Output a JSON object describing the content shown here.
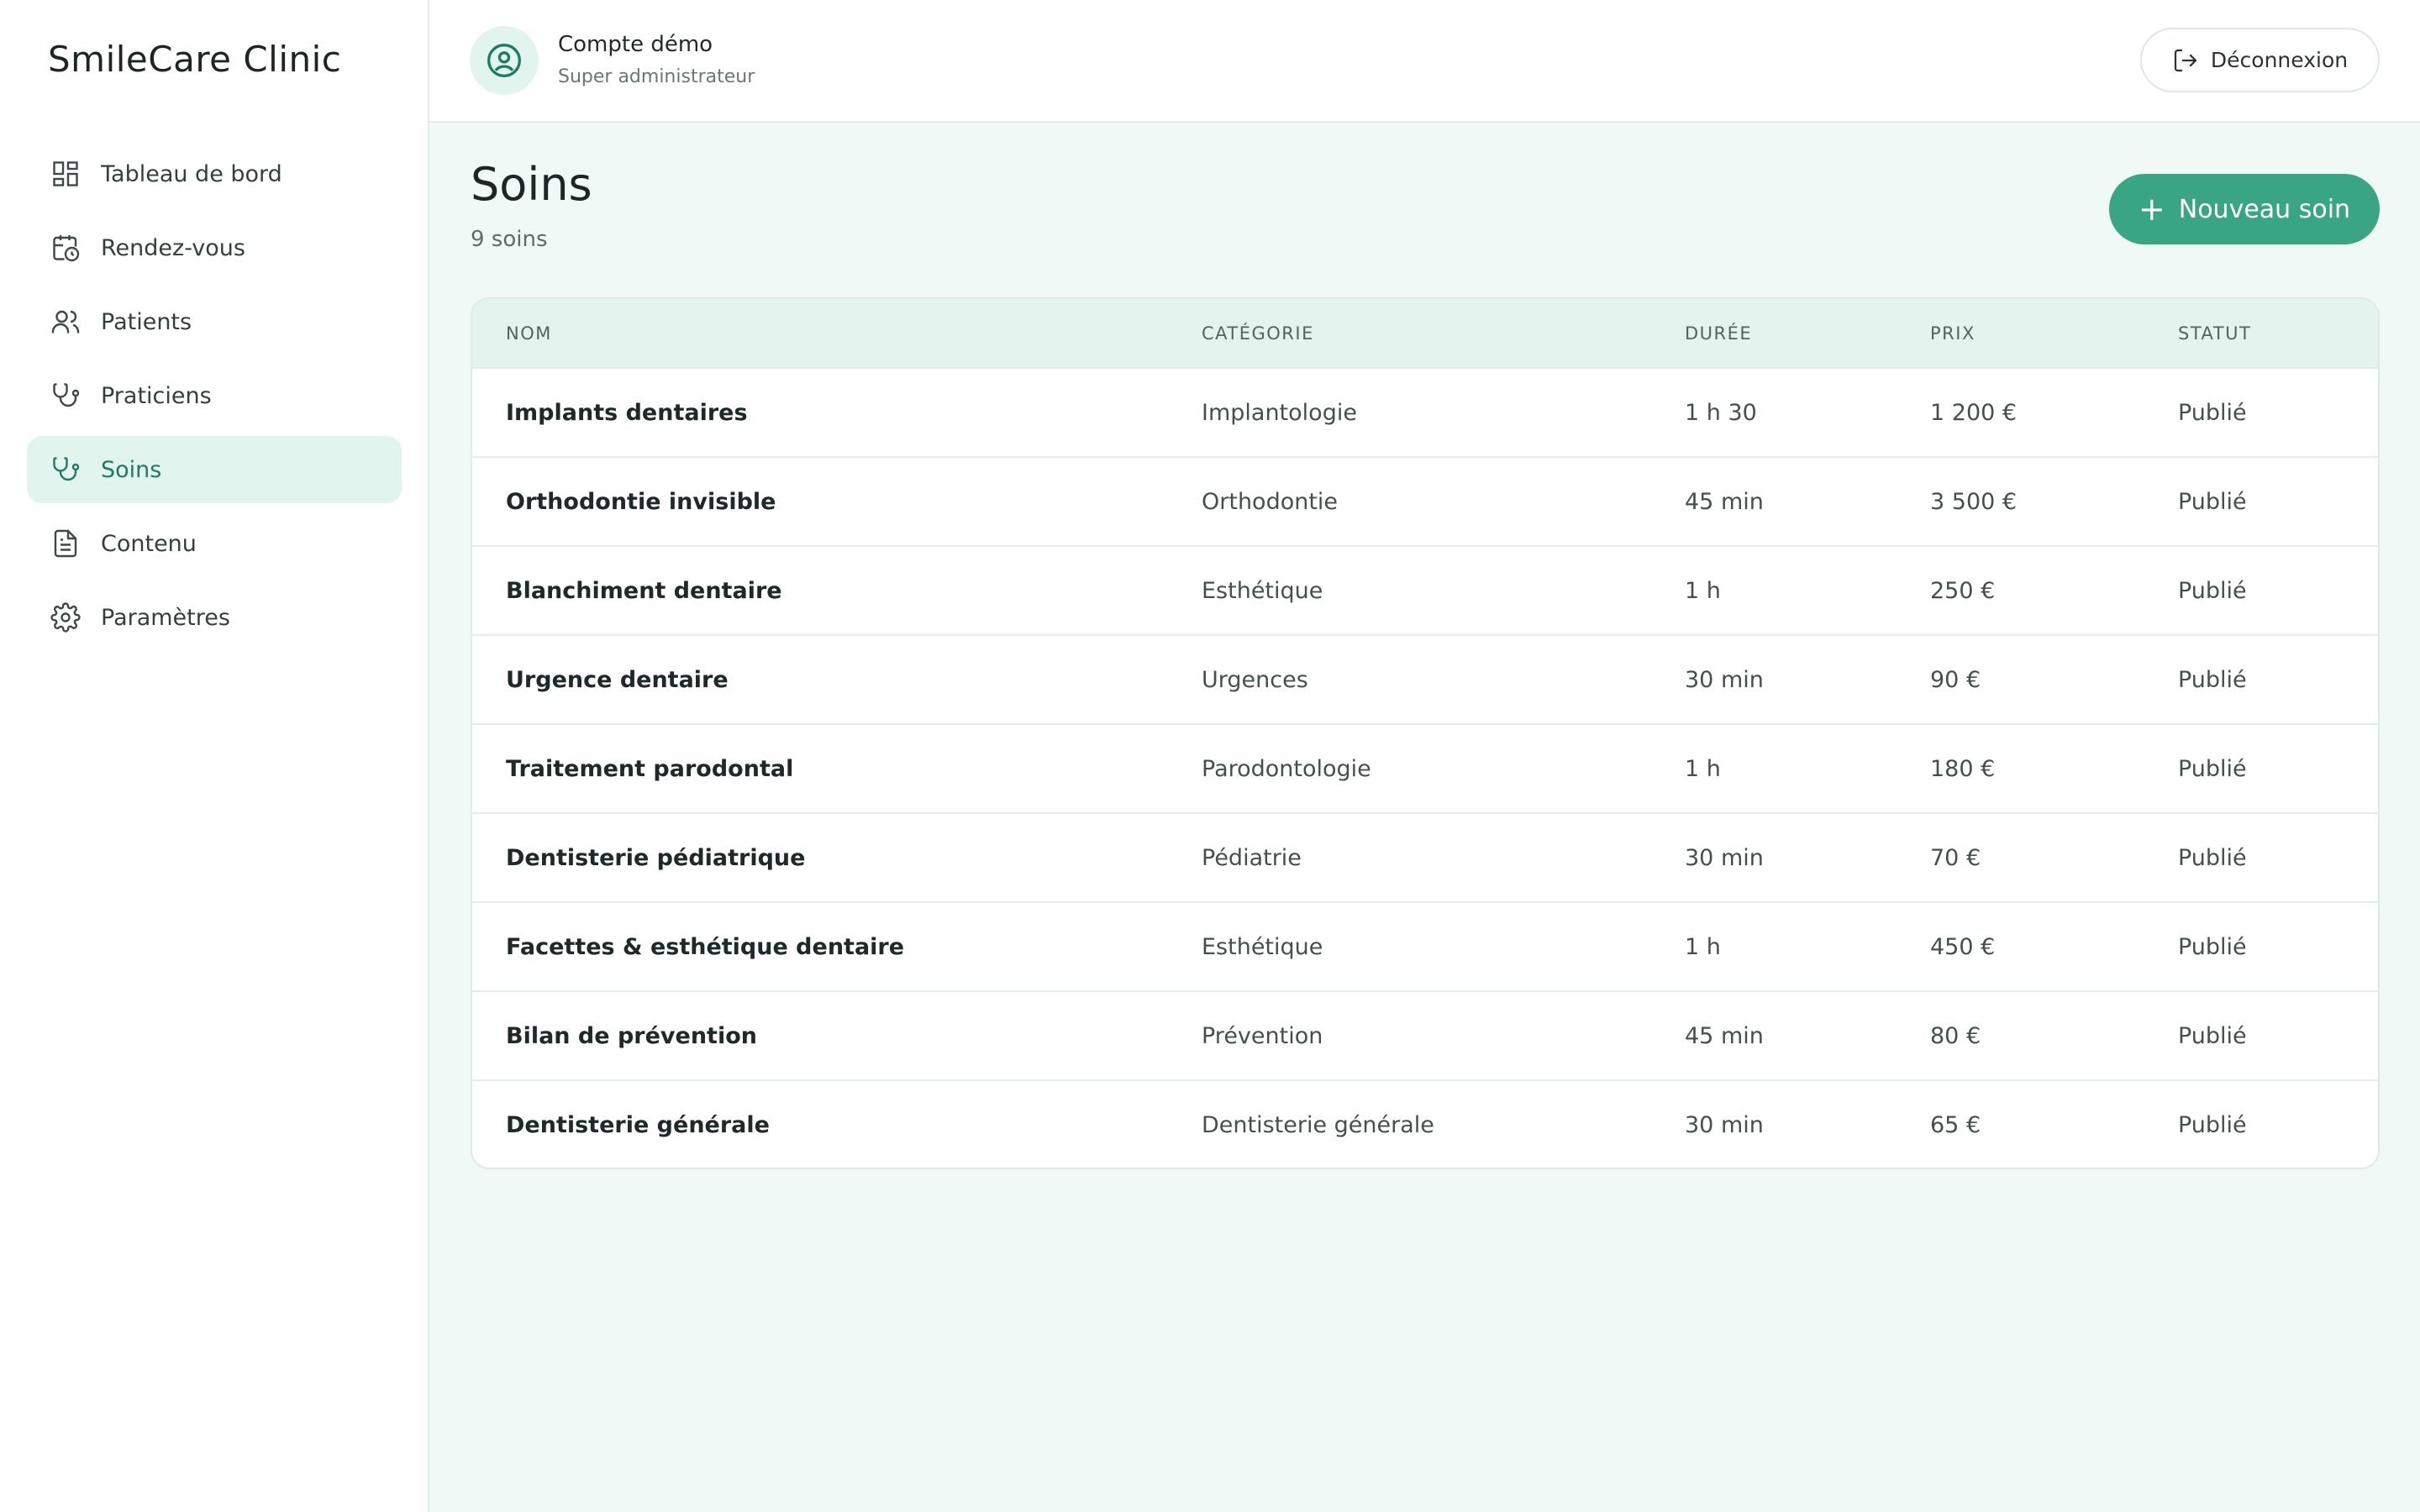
{
  "brand": "SmileCare Clinic",
  "sidebar": {
    "items": [
      {
        "label": "Tableau de bord",
        "icon": "dashboard-icon"
      },
      {
        "label": "Rendez-vous",
        "icon": "calendar-clock-icon"
      },
      {
        "label": "Patients",
        "icon": "users-icon"
      },
      {
        "label": "Praticiens",
        "icon": "stethoscope-icon"
      },
      {
        "label": "Soins",
        "icon": "stethoscope-icon",
        "active": true
      },
      {
        "label": "Contenu",
        "icon": "document-icon"
      },
      {
        "label": "Paramètres",
        "icon": "gear-icon"
      }
    ]
  },
  "header": {
    "account_name": "Compte démo",
    "account_role": "Super administrateur",
    "logout_label": "Déconnexion"
  },
  "page": {
    "title": "Soins",
    "count": "9 soins",
    "new_button": "Nouveau soin"
  },
  "table": {
    "columns": [
      "NOM",
      "CATÉGORIE",
      "DURÉE",
      "PRIX",
      "STATUT"
    ],
    "rows": [
      [
        "Implants dentaires",
        "Implantologie",
        "1 h 30",
        "1 200 €",
        "Publié"
      ],
      [
        "Orthodontie invisible",
        "Orthodontie",
        "45 min",
        "3 500 €",
        "Publié"
      ],
      [
        "Blanchiment dentaire",
        "Esthétique",
        "1 h",
        "250 €",
        "Publié"
      ],
      [
        "Urgence dentaire",
        "Urgences",
        "30 min",
        "90 €",
        "Publié"
      ],
      [
        "Traitement parodontal",
        "Parodontologie",
        "1 h",
        "180 €",
        "Publié"
      ],
      [
        "Dentisterie pédiatrique",
        "Pédiatrie",
        "30 min",
        "70 €",
        "Publié"
      ],
      [
        "Facettes & esthétique dentaire",
        "Esthétique",
        "1 h",
        "450 €",
        "Publié"
      ],
      [
        "Bilan de prévention",
        "Prévention",
        "45 min",
        "80 €",
        "Publié"
      ],
      [
        "Dentisterie générale",
        "Dentisterie générale",
        "30 min",
        "65 €",
        "Publié"
      ]
    ]
  },
  "colors": {
    "accent": "#3aa583",
    "accent_light": "#e1f4ee",
    "page_bg": "#f1f9f6"
  }
}
